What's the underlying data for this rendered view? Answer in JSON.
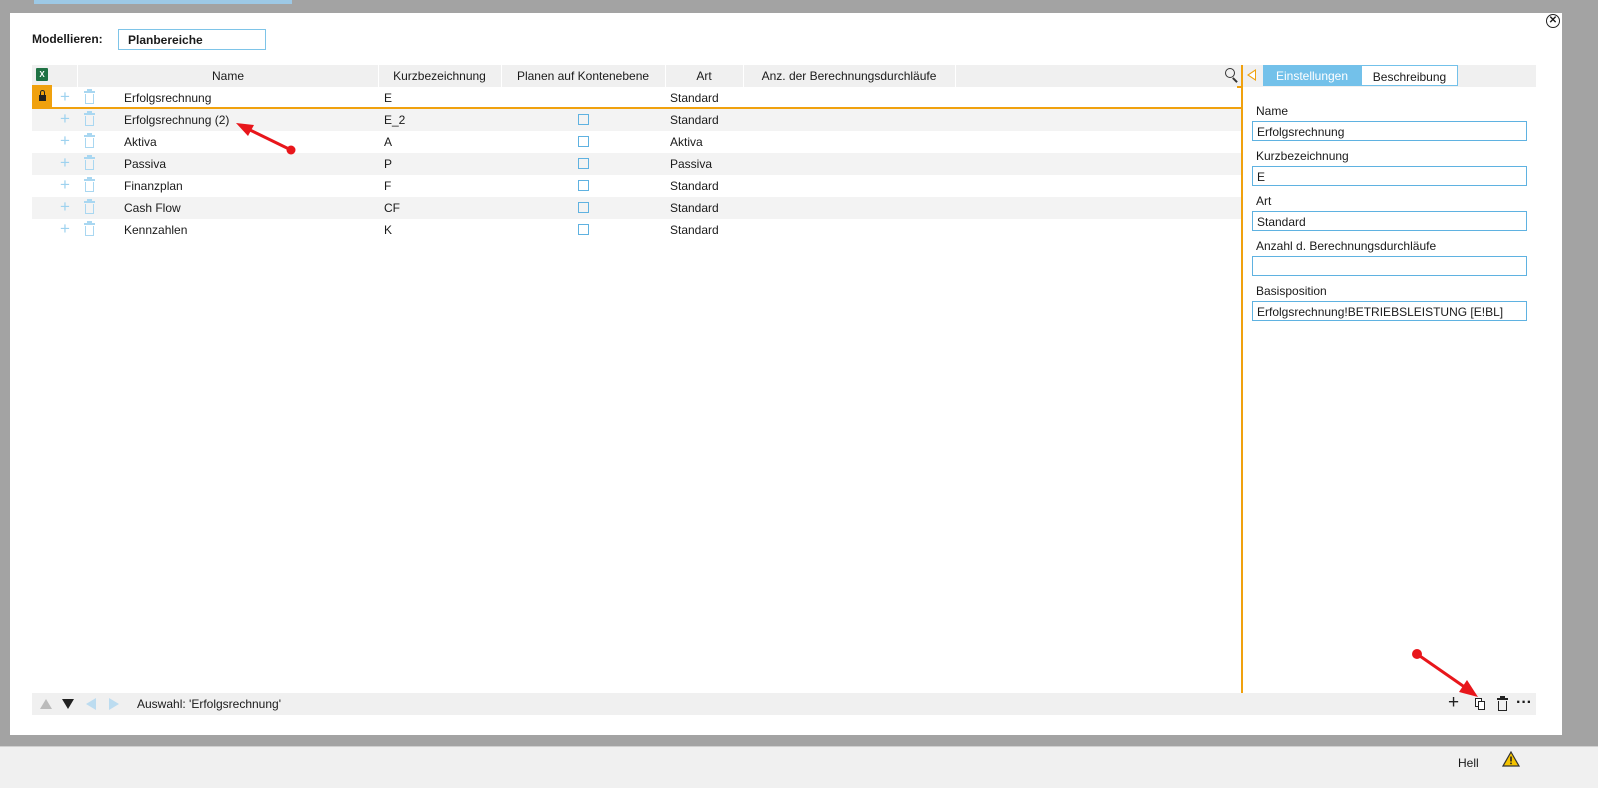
{
  "modellieren": {
    "label": "Modellieren:",
    "value": "Planbereiche"
  },
  "grid": {
    "columns": [
      "Name",
      "Kurzbezeichnung",
      "Planen auf Kontenebene",
      "Art",
      "Anz. der Berechnungsdurchläufe"
    ],
    "rows": [
      {
        "name": "Erfolgsrechnung",
        "kurz": "E",
        "art": "Standard",
        "checkbox": false,
        "selected": true
      },
      {
        "name": "Erfolgsrechnung (2)",
        "kurz": "E_2",
        "art": "Standard",
        "checkbox": true,
        "selected": false
      },
      {
        "name": "Aktiva",
        "kurz": "A",
        "art": "Aktiva",
        "checkbox": true,
        "selected": false
      },
      {
        "name": "Passiva",
        "kurz": "P",
        "art": "Passiva",
        "checkbox": true,
        "selected": false
      },
      {
        "name": "Finanzplan",
        "kurz": "F",
        "art": "Standard",
        "checkbox": true,
        "selected": false
      },
      {
        "name": "Cash Flow",
        "kurz": "CF",
        "art": "Standard",
        "checkbox": true,
        "selected": false
      },
      {
        "name": "Kennzahlen",
        "kurz": "K",
        "art": "Standard",
        "checkbox": true,
        "selected": false
      }
    ]
  },
  "side": {
    "tabs": {
      "active": "Einstellungen",
      "inactive": "Beschreibung"
    },
    "fields": {
      "name": {
        "label": "Name",
        "value": "Erfolgsrechnung"
      },
      "kurz": {
        "label": "Kurzbezeichnung",
        "value": "E"
      },
      "art": {
        "label": "Art",
        "value": "Standard"
      },
      "anzahl": {
        "label": "Anzahl d. Berechnungsdurchläufe",
        "value": ""
      },
      "basis": {
        "label": "Basisposition",
        "value": "Erfolgsrechnung!BETRIEBSLEISTUNG [E!BL]"
      }
    }
  },
  "bottom": {
    "status": "Auswahl: 'Erfolgsrechnung'"
  },
  "statusbar": {
    "theme": "Hell"
  },
  "icons": {
    "close": "close-icon",
    "excel": "excel-icon",
    "search": "search-icon",
    "lock": "lock-icon",
    "plus": "plus-icon",
    "trash": "trash-icon",
    "copy": "copy-icon",
    "more": "more-icon",
    "warning": "warning-icon"
  },
  "colors": {
    "accent": "#f0a10e",
    "tab_active": "#73c1ea",
    "annotation": "#e8161b"
  }
}
